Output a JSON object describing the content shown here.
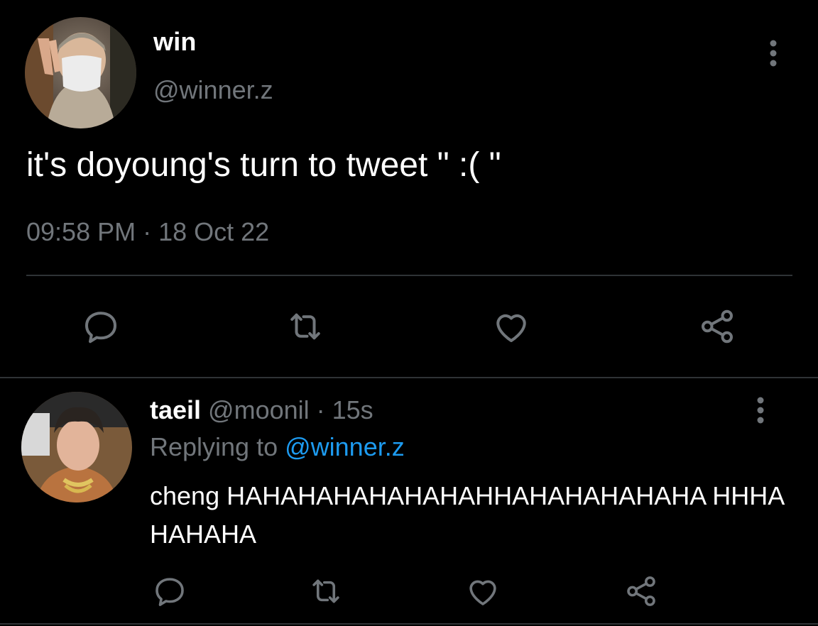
{
  "main_tweet": {
    "display_name": "win",
    "handle": "@winner.z",
    "text": "it's doyoung's turn to tweet \" :( \"",
    "timestamp": "09:58 PM · 18 Oct 22",
    "more_icon": "more-vertical-icon",
    "actions": [
      "reply-icon",
      "retweet-icon",
      "like-icon",
      "share-icon"
    ]
  },
  "reply": {
    "display_name": "taeil",
    "handle_time": " @moonil · 15s",
    "replying_prefix": "Replying to ",
    "replying_mention": "@winner.z",
    "text": "cheng HAHAHAHAHAHAHAHHAHAHAHAHAHA HHHAHAHAHA",
    "more_icon": "more-vertical-icon",
    "actions": [
      "reply-icon",
      "retweet-icon",
      "like-icon",
      "share-icon"
    ]
  },
  "colors": {
    "background": "#000000",
    "text_primary": "#ffffff",
    "text_secondary": "#71767b",
    "link": "#1d9bf0",
    "divider": "#2f3336"
  }
}
